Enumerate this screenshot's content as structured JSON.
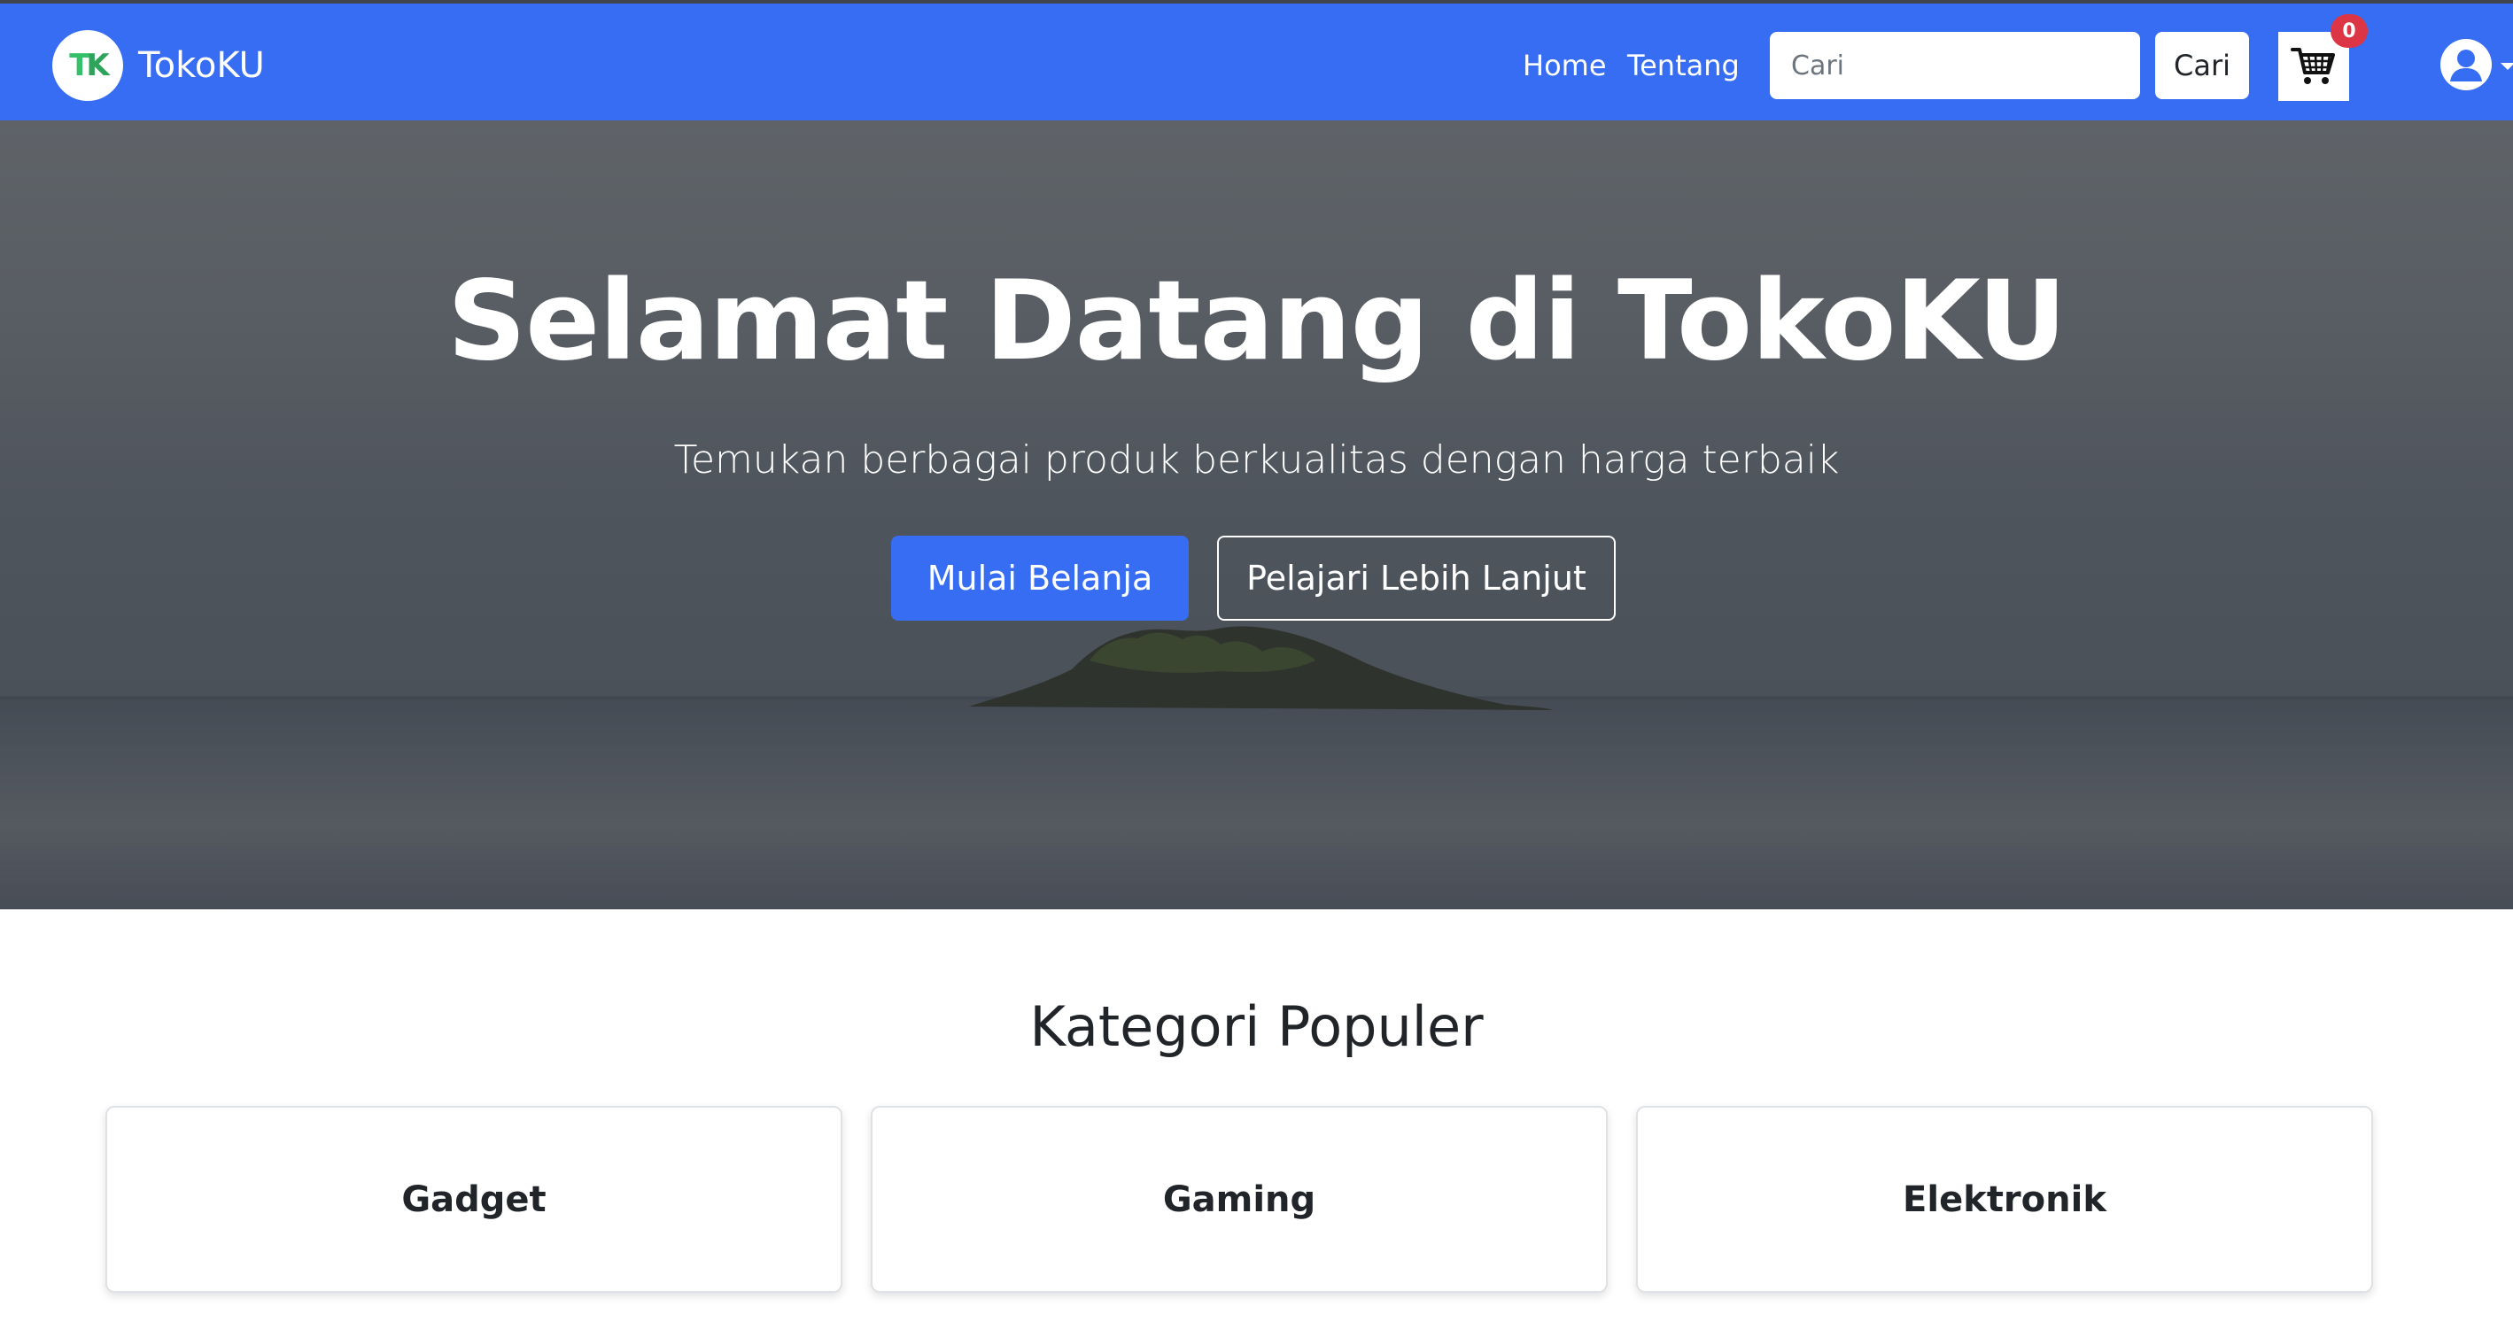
{
  "navbar": {
    "brand_name": "TokoKU",
    "logo_t": "T",
    "logo_k": "K",
    "links": [
      {
        "label": "Home"
      },
      {
        "label": "Tentang"
      }
    ],
    "search": {
      "placeholder": "Cari",
      "value": "",
      "button_label": "Cari"
    },
    "cart": {
      "icon": "shopping-cart-icon",
      "count": "0"
    },
    "user": {
      "icon": "user-avatar-icon"
    },
    "colors": {
      "background": "#366df2",
      "badge": "#dc3545"
    }
  },
  "hero": {
    "title": "Selamat Datang di TokoKU",
    "subtitle": "Temukan berbagai produk berkualitas dengan harga terbaik",
    "primary_button": "Mulai Belanja",
    "secondary_button": "Pelajari Lebih Lanjut"
  },
  "categories": {
    "title": "Kategori Populer",
    "items": [
      {
        "label": "Gadget"
      },
      {
        "label": "Gaming"
      },
      {
        "label": "Elektronik"
      }
    ]
  }
}
